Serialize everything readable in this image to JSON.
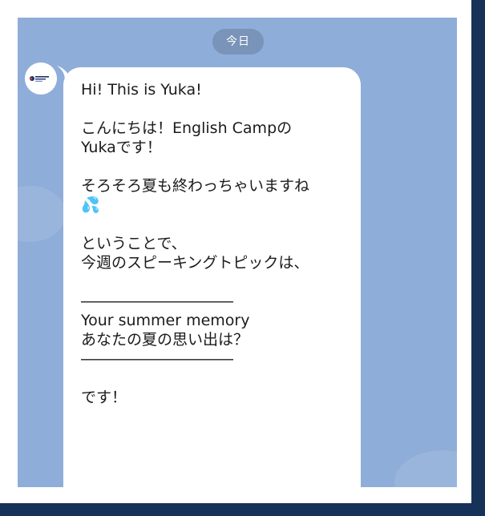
{
  "chat": {
    "date_label": "今日"
  },
  "sender": {
    "avatar_icon": "english-camp-logo-icon"
  },
  "message": {
    "text": "Hi! This is Yuka!\n\nこんにちは！English Campの\nYukaです！\n\nそろそろ夏も終わっちゃいますね\n💦\n\nということで、\n今週のスピーキングトピックは、\n\n――――――――――\nYour summer memory\nあなたの夏の思い出は？\n――――――――――\n\nです！"
  },
  "colors": {
    "chat_background": "#8fadd9",
    "date_pill": "#7a93b8",
    "bubble": "#ffffff",
    "frame_dark": "#163258",
    "text": "#1b1b1b"
  }
}
